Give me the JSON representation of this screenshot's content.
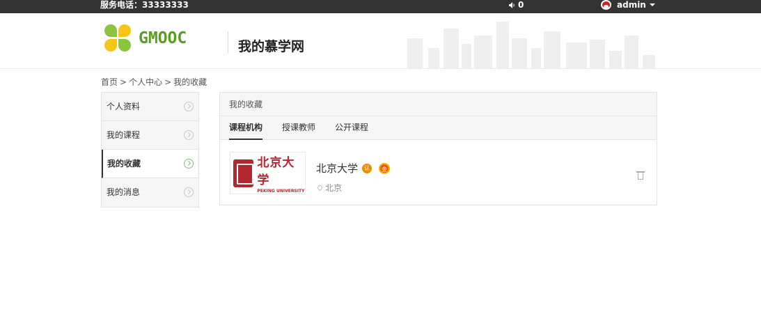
{
  "topbar": {
    "service_phone": "服务电话：33333333",
    "message_count": "0",
    "username": "admin"
  },
  "header": {
    "logo_text": "GMOOC",
    "site_title": "我的慕学网"
  },
  "breadcrumb": {
    "home": "首页",
    "center": "个人中心",
    "current": "我的收藏",
    "separator": ">"
  },
  "sidebar": {
    "items": [
      {
        "label": "个人资料"
      },
      {
        "label": "我的课程"
      },
      {
        "label": "我的收藏"
      },
      {
        "label": "我的消息"
      }
    ]
  },
  "panel": {
    "title": "我的收藏",
    "tabs": [
      {
        "label": "课程机构"
      },
      {
        "label": "授课教师"
      },
      {
        "label": "公开课程"
      }
    ]
  },
  "favorites": [
    {
      "name": "北京大学",
      "city": "北京",
      "logo_cn": "北京大学",
      "logo_en": "PEKING UNIVERSITY",
      "badge_cert": "认",
      "badge_gold": "金"
    }
  ],
  "colors": {
    "topbar_bg": "#333333",
    "brand_green": "#5a9e1f",
    "active_arrow": "#7cc576",
    "pku_red": "#b3272f"
  }
}
